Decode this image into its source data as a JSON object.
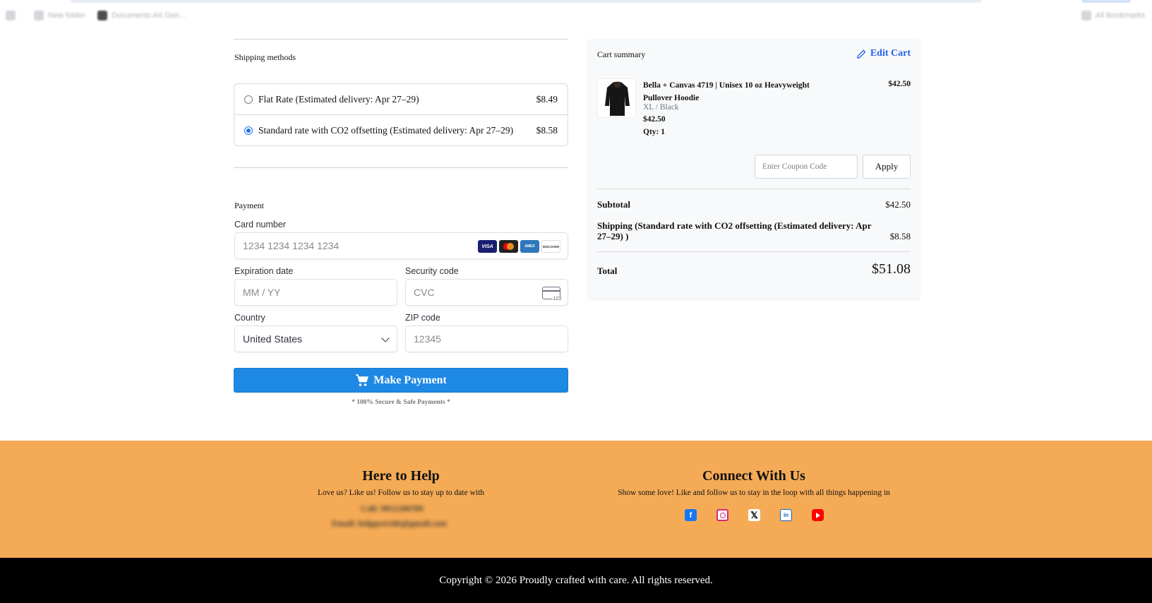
{
  "browser": {
    "bookmarks": [
      "New folder",
      "Documents Art Gen..."
    ],
    "all_bookmarks": "All Bookmarks"
  },
  "shipping": {
    "title": "Shipping methods",
    "options": [
      {
        "label": "Flat Rate (Estimated delivery: Apr 27–29)",
        "price": "$8.49",
        "selected": false
      },
      {
        "label": "Standard rate with CO2 offsetting (Estimated delivery: Apr 27–29)",
        "price": "$8.58",
        "selected": true
      }
    ]
  },
  "payment": {
    "title": "Payment",
    "card_number_label": "Card number",
    "card_number_placeholder": "1234 1234 1234 1234",
    "card_brands": [
      "VISA",
      "Mastercard",
      "AMEX",
      "DISCOVER"
    ],
    "expiry_label": "Expiration date",
    "expiry_placeholder": "MM / YY",
    "cvc_label": "Security code",
    "cvc_placeholder": "CVC",
    "country_label": "Country",
    "country_value": "United States",
    "zip_label": "ZIP code",
    "zip_placeholder": "12345",
    "button_label": "Make Payment",
    "secure_note": "* 100% Secure & Safe Payments *"
  },
  "cart": {
    "title": "Cart summary",
    "edit_label": "Edit Cart",
    "item": {
      "name": "Bella + Canvas 4719 | Unisex 10 oz Heavyweight Pullover Hoodie",
      "variant": "XL / Black",
      "unit_price": "$42.50",
      "qty": "Qty: 1",
      "price": "$42.50"
    },
    "coupon_placeholder": "Enter Coupon Code",
    "apply_label": "Apply",
    "subtotal_label": "Subtotal",
    "subtotal_value": "$42.50",
    "shipping_label": "Shipping (Standard rate with CO2 offsetting (Estimated delivery: Apr 27–29) )",
    "shipping_value": "$8.58",
    "total_label": "Total",
    "total_value": "$51.08"
  },
  "footer": {
    "help_title": "Here to Help",
    "help_text": "Love us? Like us! Follow us to stay up to date with",
    "call_label": "Call:",
    "email_label": "Email:",
    "connect_title": "Connect With Us",
    "connect_text": "Show some love! Like and follow us to stay in the loop with all things happening in",
    "social": [
      "facebook",
      "instagram",
      "x",
      "linkedin",
      "youtube"
    ],
    "copyright": "Copyright © 2026 Proudly crafted with care. All rights reserved."
  },
  "colors": {
    "accent": "#1e88e5",
    "link": "#2563eb",
    "footer_band": "#f5ab56",
    "footer_bottom": "#000000"
  }
}
